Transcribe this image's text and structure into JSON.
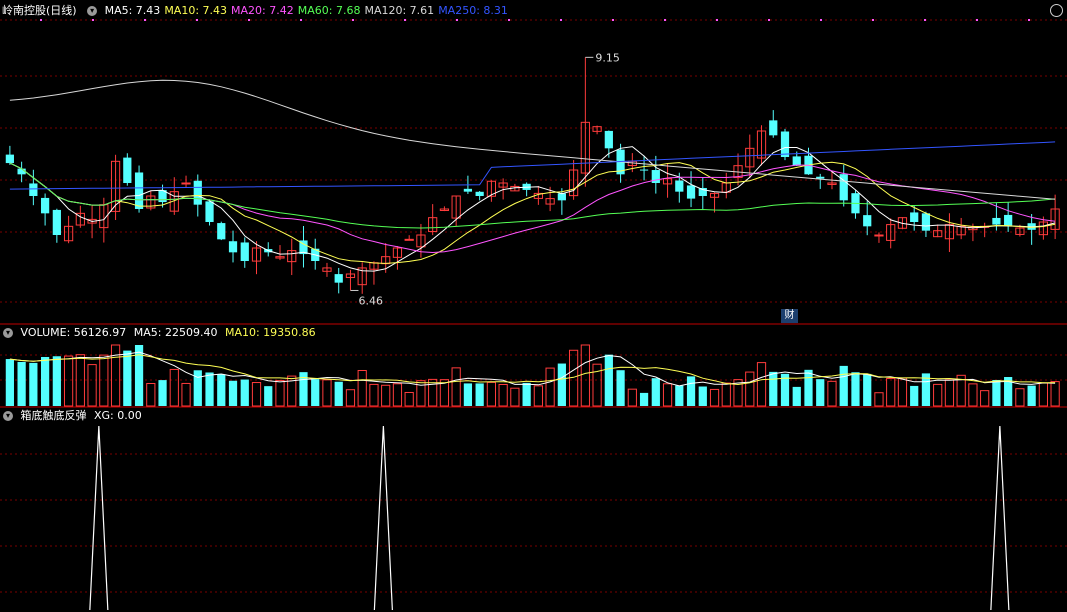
{
  "main_panel": {
    "title": "岭南控股(日线)",
    "indicators": [
      {
        "label": "MA5: 7.43",
        "color": "#ffffff"
      },
      {
        "label": "MA10: 7.43",
        "color": "#ffff55"
      },
      {
        "label": "MA20: 7.42",
        "color": "#ff55ff"
      },
      {
        "label": "MA60: 7.68",
        "color": "#55ff55"
      },
      {
        "label": "MA120: 7.61",
        "color": "#d8d8d8"
      },
      {
        "label": "MA250: 8.31",
        "color": "#3355ff"
      }
    ],
    "high_label": "9.15",
    "low_label": "6.46",
    "badge": "财"
  },
  "volume_panel": {
    "label": "VOLUME: 56126.97",
    "ma5": "MA5: 22509.40",
    "ma10": "MA10: 19350.86"
  },
  "signal_panel": {
    "label": "箱底触底反弹",
    "value": "XG: 0.00"
  },
  "colors": {
    "up": "#ff3c3c",
    "down": "#54ffff",
    "grid": "#7a0000",
    "ma5": "#ffffff",
    "ma10": "#ffff55",
    "ma20": "#ff55ff",
    "ma60": "#55ff55",
    "ma120": "#d8d8d8",
    "ma250": "#3355ff"
  },
  "chart_data": {
    "type": "candlestick",
    "price_high": 9.15,
    "price_low": 6.46,
    "close_series": [
      7.93,
      7.8,
      7.55,
      7.35,
      7.1,
      7.2,
      7.35,
      7.28,
      7.45,
      7.95,
      7.7,
      7.4,
      7.55,
      7.48,
      7.6,
      7.7,
      7.45,
      7.25,
      7.05,
      6.9,
      6.8,
      6.95,
      6.9,
      6.85,
      6.92,
      6.88,
      6.8,
      6.72,
      6.55,
      6.65,
      6.72,
      6.78,
      6.85,
      6.95,
      7.05,
      7.1,
      7.3,
      7.4,
      7.55,
      7.6,
      7.55,
      7.72,
      7.7,
      7.66,
      7.62,
      7.58,
      7.52,
      7.5,
      7.85,
      8.4,
      8.35,
      8.1,
      7.8,
      7.95,
      7.85,
      7.7,
      7.75,
      7.6,
      7.52,
      7.55,
      7.58,
      7.7,
      7.9,
      8.1,
      8.3,
      8.25,
      8.0,
      7.9,
      7.8,
      7.75,
      7.7,
      7.5,
      7.35,
      7.2,
      7.1,
      7.22,
      7.3,
      7.25,
      7.15,
      7.15,
      7.22,
      7.2,
      7.19,
      7.2,
      7.22,
      7.21,
      7.18,
      7.16,
      7.25,
      7.4
    ],
    "signals": [
      12,
      48,
      126
    ]
  }
}
